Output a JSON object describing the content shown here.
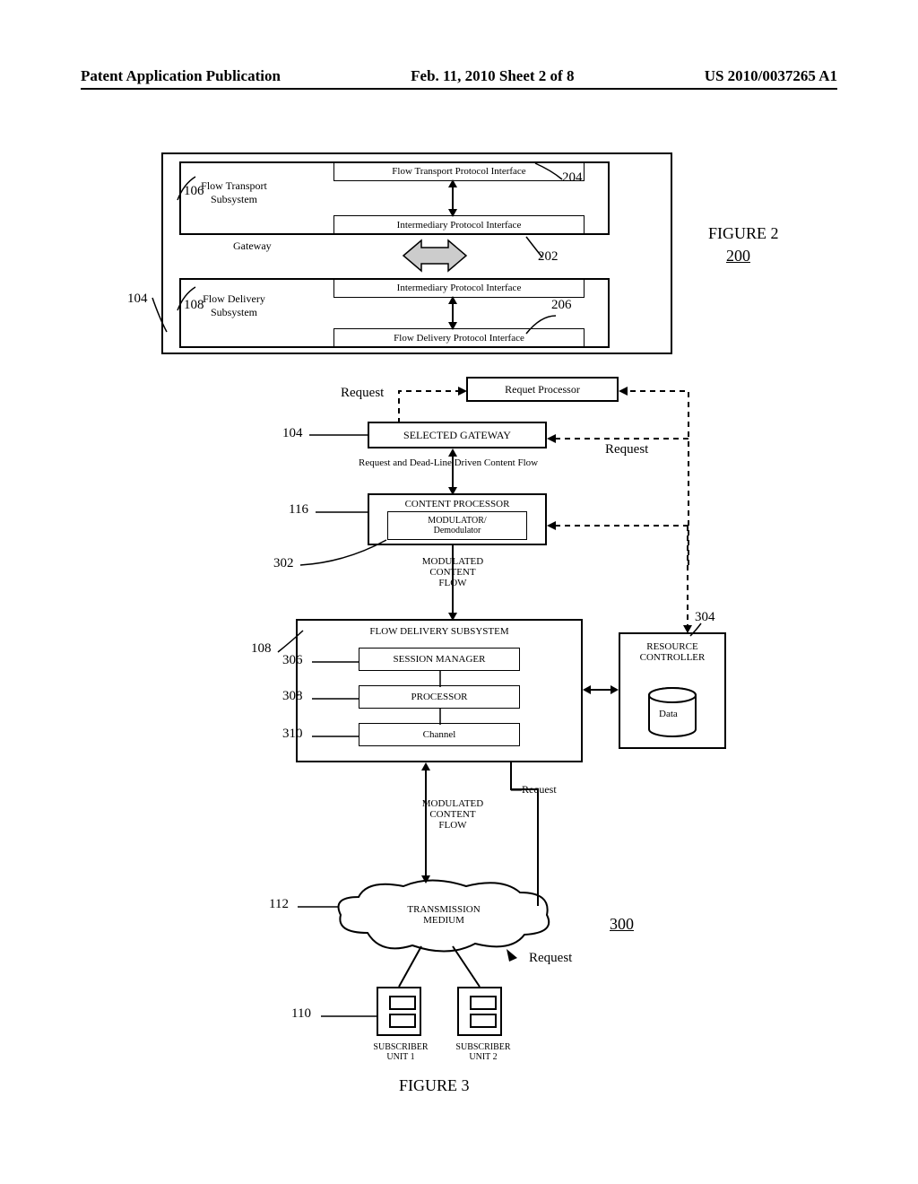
{
  "header": {
    "left": "Patent Application Publication",
    "center": "Feb. 11, 2010  Sheet 2 of 8",
    "right": "US 2010/0037265 A1"
  },
  "fig2": {
    "figure_label": "FIGURE 2",
    "figure_ref": "200",
    "ref_104": "104",
    "ref_106": "106",
    "ref_108": "108",
    "ref_202": "202",
    "ref_204": "204",
    "ref_206": "206",
    "gateway_label": "Gateway",
    "flow_transport_subsystem": "Flow Transport\nSubsystem",
    "flow_delivery_subsystem": "Flow  Delivery\nSubsystem",
    "flow_transport_protocol": "Flow Transport  Protocol  Interface",
    "intermediary_protocol": "Intermediary Protocol Interface",
    "flow_delivery_protocol": "Flow Delivery  Protocol  Interface"
  },
  "fig3": {
    "figure_label": "FIGURE 3",
    "figure_ref": "300",
    "ref_104": "104",
    "ref_108": "108",
    "ref_110": "110",
    "ref_112": "112",
    "ref_116": "116",
    "ref_302": "302",
    "ref_304": "304",
    "ref_306": "306",
    "ref_308": "308",
    "ref_310": "310",
    "request_processor": "Requet Processor",
    "selected_gateway": "SELECTED GATEWAY",
    "content_processor": "CONTENT PROCESSOR",
    "modulator": "MODULATOR/\nDemodulator",
    "flow_delivery_subsystem": "FLOW DELIVERY SUBSYSTEM",
    "session_manager": "SESSION MANAGER",
    "processor": "PROCESSOR",
    "channel": "Channel",
    "resource_controller": "RESOURCE\nCONTROLLER",
    "data": "Data",
    "transmission_medium": "TRANSMISSION\nMEDIUM",
    "subscriber1": "SUBSCRIBER\nUNIT 1",
    "subscriber2": "SUBSCRIBER\nUNIT 2",
    "request_label": "Request",
    "modulated_content_flow": "MODULATED\nCONTENT\nFLOW",
    "request_deadline": "Request and Dead-Line Driven Content Flow"
  }
}
